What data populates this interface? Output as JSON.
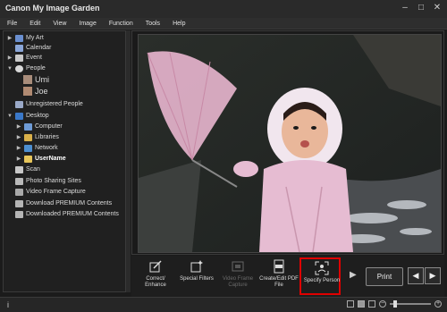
{
  "app": {
    "title": "Canon My Image Garden"
  },
  "window_controls": {
    "minimize": "–",
    "maximize": "□",
    "close": "✕"
  },
  "menu": [
    "File",
    "Edit",
    "View",
    "Image",
    "Function",
    "Tools",
    "Help"
  ],
  "sidebar": {
    "items": [
      {
        "label": "My Art",
        "arrow": "▶",
        "icon": "my-art-icon"
      },
      {
        "label": "Calendar",
        "arrow": "",
        "icon": "calendar-icon"
      },
      {
        "label": "Event",
        "arrow": "▶",
        "icon": "event-icon"
      },
      {
        "label": "People",
        "arrow": "▼",
        "icon": "people-icon"
      },
      {
        "label": "Umi",
        "arrow": "",
        "icon": "person-thumbnail-icon"
      },
      {
        "label": "Joe",
        "arrow": "",
        "icon": "person-thumbnail-icon"
      },
      {
        "label": "Unregistered People",
        "arrow": "",
        "icon": "unregistered-people-icon"
      },
      {
        "label": "Desktop",
        "arrow": "▼",
        "icon": "desktop-icon"
      },
      {
        "label": "Computer",
        "arrow": "▶",
        "icon": "computer-icon"
      },
      {
        "label": "Libraries",
        "arrow": "▶",
        "icon": "libraries-icon"
      },
      {
        "label": "Network",
        "arrow": "▶",
        "icon": "network-icon"
      },
      {
        "label": "UserName",
        "arrow": "▶",
        "icon": "user-folder-icon"
      },
      {
        "label": "Scan",
        "arrow": "",
        "icon": "scan-icon"
      },
      {
        "label": "Photo Sharing Sites",
        "arrow": "",
        "icon": "photo-sharing-icon"
      },
      {
        "label": "Video Frame Capture",
        "arrow": "",
        "icon": "video-frame-icon"
      },
      {
        "label": "Download PREMIUM Contents",
        "arrow": "",
        "icon": "download-icon"
      },
      {
        "label": "Downloaded PREMIUM Contents",
        "arrow": "",
        "icon": "downloaded-icon"
      }
    ]
  },
  "toolbar": {
    "buttons": [
      {
        "label": "Correct/ Enhance"
      },
      {
        "label": "Special Filters"
      },
      {
        "label": "Video Frame Capture"
      },
      {
        "label": "Create/Edit PDF File"
      },
      {
        "label": "Specify Person"
      }
    ],
    "more_arrow": "▶",
    "print_label": "Print",
    "prev_arrow": "◀",
    "next_arrow": "▶"
  },
  "statusbar": {
    "info_icon": "i",
    "zoom_minus": "−",
    "zoom_plus": "+"
  },
  "colors": {
    "highlight": "#e00000",
    "background": "#1b1b1b"
  }
}
